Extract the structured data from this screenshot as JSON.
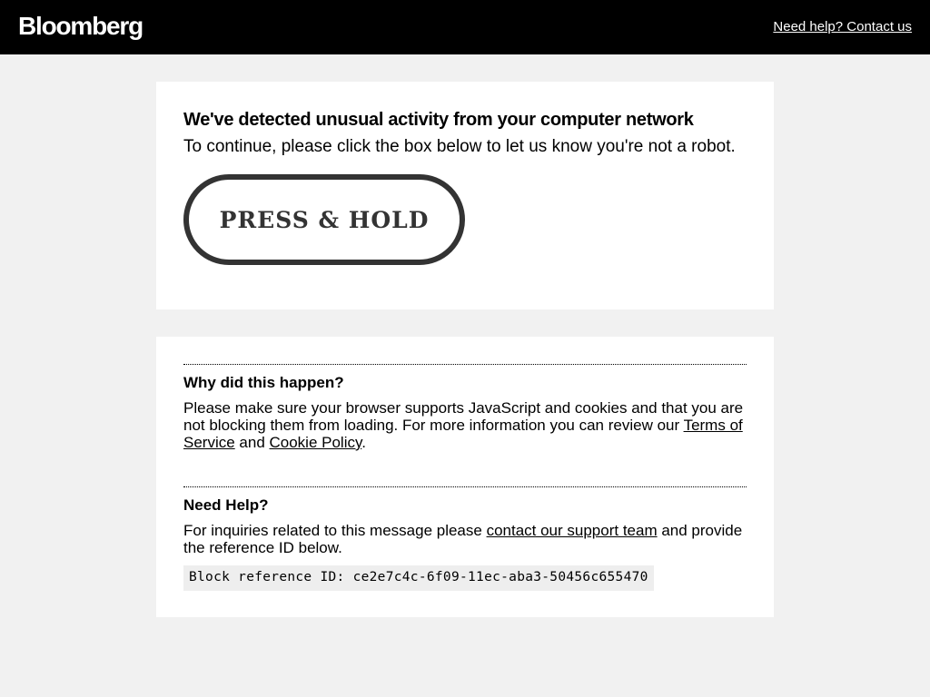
{
  "header": {
    "logo": "Bloomberg",
    "help_link": "Need help? Contact us"
  },
  "challenge": {
    "heading": "We've detected unusual activity from your computer network",
    "subtext": "To continue, please click the box below to let us know you're not a robot.",
    "button_label": "PRESS & HOLD"
  },
  "why": {
    "title": "Why did this happen?",
    "text_1": "Please make sure your browser supports JavaScript and cookies and that you are not blocking them from loading. For more information you can review our ",
    "terms_link": "Terms of Service",
    "text_2": " and ",
    "cookie_link": "Cookie Policy",
    "text_3": "."
  },
  "help": {
    "title": "Need Help?",
    "text_1": "For inquiries related to this message please ",
    "support_link": "contact our support team",
    "text_2": " and provide the reference ID below.",
    "reference": "Block reference ID: ce2e7c4c-6f09-11ec-aba3-50456c655470"
  }
}
